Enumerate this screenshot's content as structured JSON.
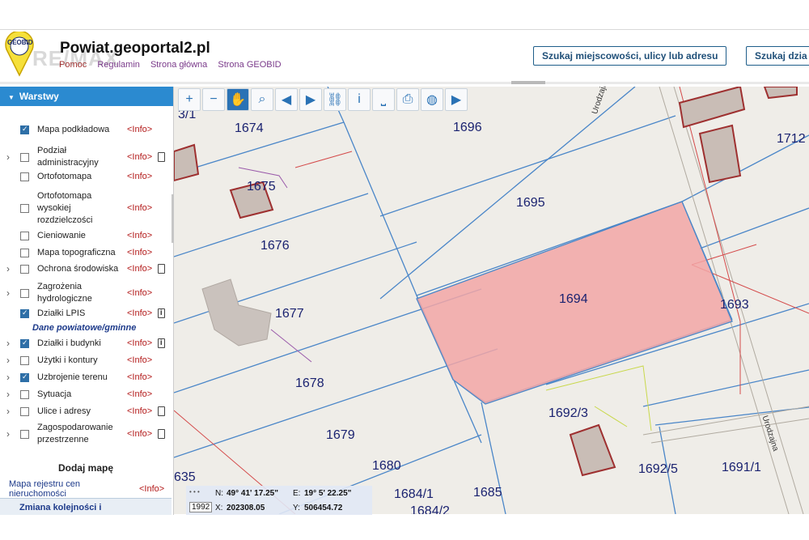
{
  "header": {
    "site_title": "Powiat.geoportal2.pl",
    "logo_text": "GEOBID",
    "watermark": "RE/MAX",
    "links": [
      "Pomoc",
      "Regulamin",
      "Strona główna",
      "Strona GEOBID"
    ],
    "search_button_1": "Szukaj miejscowości, ulicy lub adresu",
    "search_button_2": "Szukaj dzia"
  },
  "sidebar": {
    "panel_title": "Warstwy",
    "info_label": "<Info>",
    "layers": [
      {
        "label": "Mapa podkładowa",
        "checked": true,
        "expandable": false,
        "doc": ""
      },
      {
        "label": "Podział administracyjny",
        "checked": false,
        "expandable": true,
        "doc": "doc"
      },
      {
        "label": "Ortofotomapa",
        "checked": false,
        "expandable": false,
        "doc": ""
      },
      {
        "label": "Ortofotomapa wysokiej rozdzielczości",
        "checked": false,
        "expandable": false,
        "doc": ""
      },
      {
        "label": "Cieniowanie",
        "checked": false,
        "expandable": false,
        "doc": ""
      },
      {
        "label": "Mapa topograficzna",
        "checked": false,
        "expandable": false,
        "doc": ""
      },
      {
        "label": "Ochrona środowiska",
        "checked": false,
        "expandable": true,
        "doc": "doc"
      },
      {
        "label": "Zagrożenia hydrologiczne",
        "checked": false,
        "expandable": true,
        "doc": ""
      },
      {
        "label": "Działki LPIS",
        "checked": true,
        "expandable": false,
        "doc": "info"
      },
      {
        "label": "Działki i budynki",
        "checked": true,
        "expandable": true,
        "doc": "info"
      },
      {
        "label": "Użytki i kontury",
        "checked": false,
        "expandable": true,
        "doc": ""
      },
      {
        "label": "Uzbrojenie terenu",
        "checked": true,
        "expandable": true,
        "doc": ""
      },
      {
        "label": "Sytuacja",
        "checked": false,
        "expandable": true,
        "doc": ""
      },
      {
        "label": "Ulice i adresy",
        "checked": false,
        "expandable": true,
        "doc": "doc"
      },
      {
        "label": "Zagospodarowanie przestrzenne",
        "checked": false,
        "expandable": true,
        "doc": "doc"
      }
    ],
    "group_title": "Dane powiatowe/gminne",
    "add_map": "Dodaj mapę",
    "price_map": "Mapa rejestru cen nieruchomości",
    "order_label": "Zmiana kolejności i"
  },
  "map": {
    "parcels": [
      "1674",
      "1675",
      "1676",
      "1677",
      "1678",
      "1679",
      "1680",
      "1684/1",
      "1684/2",
      "1685",
      "1693",
      "1694",
      "1695",
      "1696",
      "1692/3",
      "1692/5",
      "1691/1",
      "1712",
      "635",
      "3/1"
    ],
    "street_label": "Urodzajna",
    "highlighted_parcel": "1694",
    "highlight_color": "#f2a6a6"
  },
  "toolbar": {
    "tools": [
      {
        "name": "zoom-in-icon",
        "glyph": "+"
      },
      {
        "name": "zoom-out-icon",
        "glyph": "−"
      },
      {
        "name": "pan-hand-icon",
        "glyph": "✋"
      },
      {
        "name": "zoom-area-icon",
        "glyph": "⌕"
      },
      {
        "name": "back-arrow-icon",
        "glyph": "◀"
      },
      {
        "name": "forward-arrow-icon",
        "glyph": "▶"
      },
      {
        "name": "link-icon",
        "glyph": "⛓"
      },
      {
        "name": "info-icon",
        "glyph": "i"
      },
      {
        "name": "measure-icon",
        "glyph": "⎵"
      },
      {
        "name": "print-icon",
        "glyph": "⎙"
      },
      {
        "name": "globe-icon",
        "glyph": "◍"
      },
      {
        "name": "camera-icon",
        "glyph": "▶"
      }
    ]
  },
  "coords": {
    "system": "1992",
    "n_label": "N:",
    "n_value": "49° 41' 17.25\"",
    "e_label": "E:",
    "e_value": "19° 5' 22.25\"",
    "x_label": "X:",
    "x_value": "202308.05",
    "y_label": "Y:",
    "y_value": "506454.72"
  }
}
